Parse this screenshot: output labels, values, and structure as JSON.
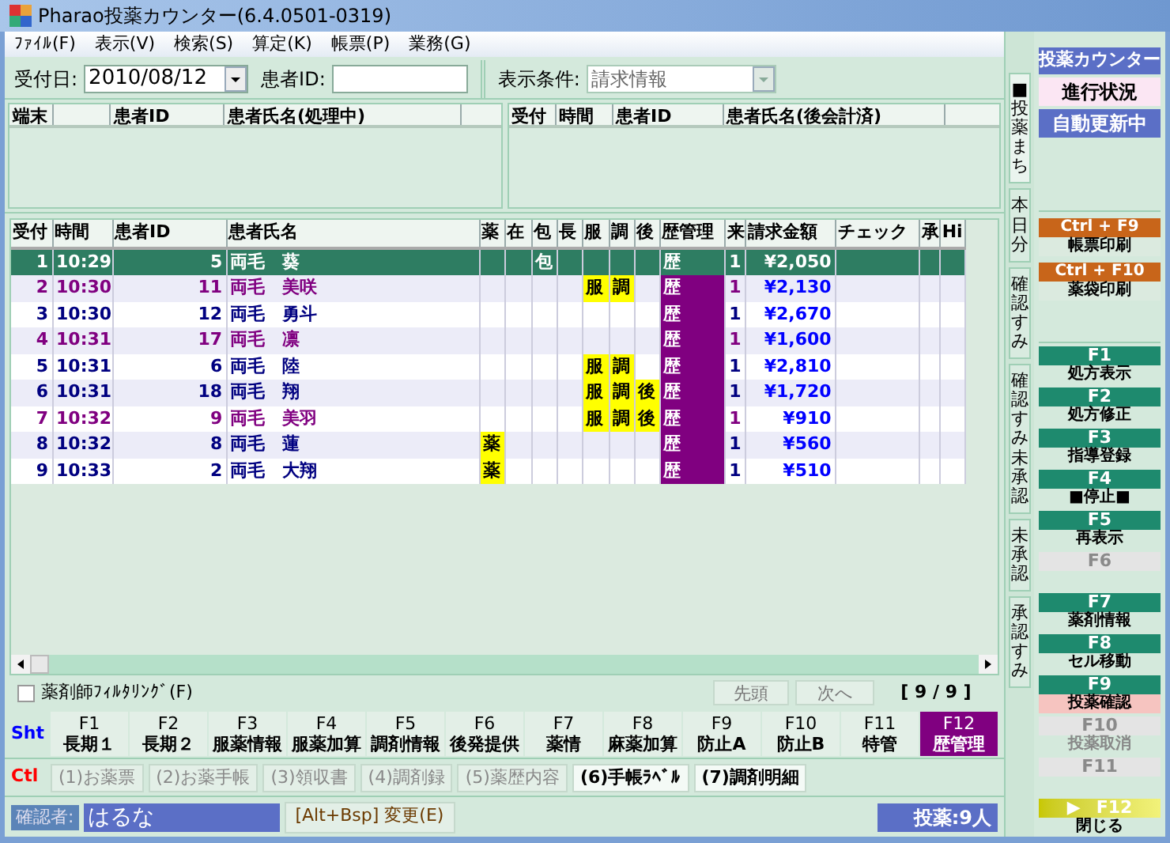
{
  "window": {
    "title": "Pharao投薬カウンター(6.4.0501-0319)"
  },
  "menu": [
    "ﾌｧｲﾙ(F)",
    "表示(V)",
    "検索(S)",
    "算定(K)",
    "帳票(P)",
    "業務(G)"
  ],
  "filter": {
    "date_label": "受付日:",
    "date": "2010/08/12",
    "patient_id_label": "患者ID:",
    "condition_label": "表示条件:",
    "condition": "請求情報"
  },
  "processing": {
    "columns": [
      "端末",
      "",
      "患者ID",
      "患者氏名(処理中)"
    ]
  },
  "checked_out": {
    "columns": [
      "受付",
      "時間",
      "患者ID",
      "患者氏名(後会計済)"
    ]
  },
  "table": {
    "columns": [
      "受付",
      "時間",
      "患者ID",
      "患者氏名",
      "薬",
      "在",
      "包",
      "長",
      "服",
      "調",
      "後",
      "歴管理",
      "来",
      "請求金額",
      "チェック",
      "承",
      "Hi"
    ],
    "rows": [
      {
        "no": "1",
        "time": "10:29",
        "id": "5",
        "name": "両毛　葵",
        "hou": "包",
        "reki": "歴",
        "rai": "1",
        "amount": "¥2,050",
        "selected": true
      },
      {
        "no": "2",
        "time": "10:30",
        "id": "11",
        "name": "両毛　美咲",
        "fuku": "服",
        "chou": "調",
        "reki": "歴",
        "rai": "1",
        "amount": "¥2,130",
        "selected": false,
        "color": "#800080"
      },
      {
        "no": "3",
        "time": "10:30",
        "id": "12",
        "name": "両毛　勇斗",
        "reki": "歴",
        "rai": "1",
        "amount": "¥2,670",
        "selected": false,
        "color": "#000080"
      },
      {
        "no": "4",
        "time": "10:31",
        "id": "17",
        "name": "両毛　凛",
        "reki": "歴",
        "rai": "1",
        "amount": "¥1,600",
        "selected": false,
        "color": "#800080"
      },
      {
        "no": "5",
        "time": "10:31",
        "id": "6",
        "name": "両毛　陸",
        "fuku": "服",
        "chou": "調",
        "reki": "歴",
        "rai": "1",
        "amount": "¥2,810",
        "selected": false,
        "color": "#000080"
      },
      {
        "no": "6",
        "time": "10:31",
        "id": "18",
        "name": "両毛　翔",
        "fuku": "服",
        "chou": "調",
        "go": "後",
        "reki": "歴",
        "rai": "1",
        "amount": "¥1,720",
        "selected": false,
        "color": "#000080"
      },
      {
        "no": "7",
        "time": "10:32",
        "id": "9",
        "name": "両毛　美羽",
        "fuku": "服",
        "chou": "調",
        "go": "後",
        "reki": "歴",
        "rai": "1",
        "amount": "¥910",
        "selected": false,
        "color": "#800080"
      },
      {
        "no": "8",
        "time": "10:32",
        "id": "8",
        "name": "両毛　蓮",
        "yaku": "薬",
        "reki": "歴",
        "rai": "1",
        "amount": "¥560",
        "selected": false,
        "color": "#000080"
      },
      {
        "no": "9",
        "time": "10:33",
        "id": "2",
        "name": "両毛　大翔",
        "yaku": "薬",
        "reki": "歴",
        "rai": "1",
        "amount": "¥510",
        "selected": false,
        "color": "#000080"
      }
    ]
  },
  "pharmacist_filter": {
    "label": "薬剤師ﾌｨﾙﾀﾘﾝｸﾞ(F)",
    "checked": false
  },
  "nav": {
    "first": "先頭",
    "next": "次へ",
    "count": "[ 9 / 9 ]"
  },
  "shift_keys": {
    "label": "Sht",
    "keys": [
      {
        "key": "F1",
        "label": "長期１",
        "selected": false
      },
      {
        "key": "F2",
        "label": "長期２",
        "selected": false
      },
      {
        "key": "F3",
        "label": "服薬情報",
        "selected": false
      },
      {
        "key": "F4",
        "label": "服薬加算",
        "selected": false
      },
      {
        "key": "F5",
        "label": "調剤情報",
        "selected": false
      },
      {
        "key": "F6",
        "label": "後発提供",
        "selected": false
      },
      {
        "key": "F7",
        "label": "薬情",
        "selected": false
      },
      {
        "key": "F8",
        "label": "麻薬加算",
        "selected": false
      },
      {
        "key": "F9",
        "label": "防止A",
        "selected": false
      },
      {
        "key": "F10",
        "label": "防止B",
        "selected": false
      },
      {
        "key": "F11",
        "label": "特管",
        "selected": false
      },
      {
        "key": "F12",
        "label": "歴管理",
        "selected": true
      }
    ]
  },
  "ctrl_keys": {
    "label": "Ctl",
    "buttons": [
      {
        "label": "(1)お薬票",
        "disabled": true
      },
      {
        "label": "(2)お薬手帳",
        "disabled": true
      },
      {
        "label": "(3)領収書",
        "disabled": true
      },
      {
        "label": "(4)調剤録",
        "disabled": true
      },
      {
        "label": "(5)薬歴内容",
        "disabled": true
      },
      {
        "label": "(6)手帳ﾗﾍﾞﾙ",
        "disabled": false
      },
      {
        "label": "(7)調剤明細",
        "disabled": false
      }
    ]
  },
  "status": {
    "confirmer_label": "確認者:",
    "confirmer": "はるな",
    "change_button": "[Alt+Bsp] 変更(E)",
    "count": "投薬:9人"
  },
  "side_tabs": [
    {
      "label": "■投薬まち",
      "selected": true
    },
    {
      "label": "本日分",
      "selected": false
    },
    {
      "label": "確認すみ",
      "selected": false
    },
    {
      "label": "確認すみ未承認",
      "selected": false
    },
    {
      "label": "未承認",
      "selected": false
    },
    {
      "label": "承認すみ",
      "selected": false
    }
  ],
  "panel": {
    "title": "投薬カウンター",
    "progress": "進行状況",
    "auto_update": "自動更新中"
  },
  "print_keys": [
    {
      "key": "Ctrl + F9",
      "label": "帳票印刷"
    },
    {
      "key": "Ctrl + F10",
      "label": "薬袋印刷"
    }
  ],
  "function_keys": [
    {
      "key": "F1",
      "label": "処方表示",
      "disabled": false,
      "kind": "normal"
    },
    {
      "key": "F2",
      "label": "処方修正",
      "disabled": false,
      "kind": "normal"
    },
    {
      "key": "F3",
      "label": "指導登録",
      "disabled": false,
      "kind": "normal"
    },
    {
      "key": "F4",
      "label": "■停止■",
      "disabled": false,
      "kind": "normal"
    },
    {
      "key": "F5",
      "label": "再表示",
      "disabled": false,
      "kind": "normal"
    },
    {
      "key": "F6",
      "disabled": true,
      "kind": "normal"
    },
    {
      "key": "F7",
      "label": "薬剤情報",
      "disabled": false,
      "kind": "normal"
    },
    {
      "key": "F8",
      "label": "セル移動",
      "disabled": false,
      "kind": "normal"
    },
    {
      "key": "F9",
      "label": "投薬確認",
      "disabled": false,
      "kind": "alert"
    },
    {
      "key": "F10",
      "label": "投薬取消",
      "disabled": true,
      "kind": "normal"
    },
    {
      "key": "F11",
      "disabled": true,
      "kind": "normal"
    },
    {
      "key": "F12",
      "label": "閉じる",
      "disabled": false,
      "kind": "close",
      "marker": "▶"
    }
  ]
}
